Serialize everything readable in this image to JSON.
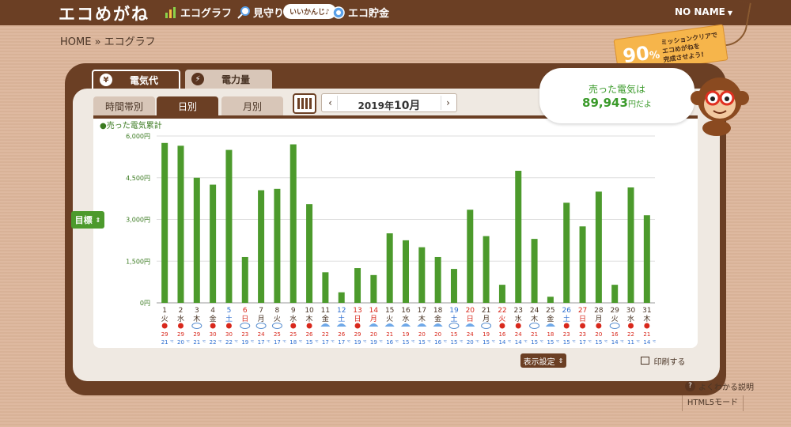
{
  "header": {
    "logo": "エコめがね",
    "nav": [
      {
        "label": "エコグラフ",
        "icon": "bar-chart-icon"
      },
      {
        "label": "見守り",
        "icon": "magnifier-icon"
      },
      {
        "label": "エコ貯金",
        "icon": "coin-icon"
      }
    ],
    "bubble": "いいかんじ♪",
    "user": "NO NAME"
  },
  "breadcrumb": "HOME » エコグラフ",
  "mission": {
    "percent": "90",
    "unit": "%",
    "text1": "ミッションクリアで",
    "text2": "エコめがねを",
    "text3": "完成させよう!"
  },
  "tabs": {
    "cost": "電気代",
    "amount": "電力量",
    "cost_icon": "¥",
    "amount_icon": "⚡"
  },
  "subtabs": [
    "時間帯別",
    "日別",
    "月別"
  ],
  "month": {
    "year": "2019年",
    "month": "10月"
  },
  "sold": {
    "label": "売った電気は",
    "value": "89,943",
    "unit": "円だよ"
  },
  "goal_button": "目標",
  "display_settings": "表示設定",
  "print": "印刷する",
  "help": "よくわかる説明",
  "html5": "HTML5モード",
  "colors": {
    "brown": "#6b3f24",
    "green": "#4c9a2c",
    "red": "#d8281c",
    "blue": "#2f6fd0"
  },
  "chart_data": {
    "type": "bar",
    "title": "●売った電気累計",
    "ylim": [
      0,
      6000
    ],
    "yticks": [
      "0円",
      "1,500円",
      "3,000円",
      "4,500円",
      "6,000円"
    ],
    "ytick_values": [
      0,
      1500,
      3000,
      4500,
      6000
    ],
    "categories": [
      "1",
      "2",
      "3",
      "4",
      "5",
      "6",
      "7",
      "8",
      "9",
      "10",
      "11",
      "12",
      "13",
      "14",
      "15",
      "16",
      "17",
      "18",
      "19",
      "20",
      "21",
      "22",
      "23",
      "24",
      "25",
      "26",
      "27",
      "28",
      "29",
      "30",
      "31"
    ],
    "weekdays": [
      "火",
      "水",
      "木",
      "金",
      "土",
      "日",
      "月",
      "火",
      "水",
      "木",
      "金",
      "土",
      "日",
      "月",
      "火",
      "水",
      "木",
      "金",
      "土",
      "日",
      "月",
      "火",
      "水",
      "木",
      "金",
      "土",
      "日",
      "月",
      "火",
      "水",
      "木"
    ],
    "holidays": [
      6,
      13,
      14,
      20,
      22,
      27
    ],
    "saturdays": [
      5,
      12,
      19,
      26
    ],
    "values": [
      5750,
      5650,
      4500,
      4250,
      5500,
      1650,
      4050,
      4100,
      5700,
      3550,
      1100,
      380,
      1250,
      1000,
      2500,
      2250,
      2000,
      1650,
      1220,
      3350,
      2400,
      650,
      4750,
      2300,
      220,
      3600,
      2750,
      4000,
      650,
      4150,
      3150
    ],
    "high": [
      29,
      29,
      29,
      30,
      30,
      23,
      24,
      25,
      25,
      26,
      22,
      26,
      29,
      20,
      21,
      19,
      20,
      20,
      15,
      24,
      19,
      16,
      24,
      21,
      18,
      23,
      23,
      20,
      16,
      22,
      21
    ],
    "low": [
      21,
      20,
      21,
      22,
      22,
      19,
      17,
      17,
      18,
      15,
      17,
      17,
      19,
      19,
      16,
      15,
      15,
      16,
      15,
      20,
      15,
      14,
      14,
      15,
      15,
      15,
      17,
      15,
      14,
      11,
      14
    ],
    "weather": [
      "sun",
      "sun",
      "cloud",
      "sun",
      "sun",
      "cloud",
      "cloud",
      "cloud",
      "sun",
      "sun",
      "rain",
      "rain",
      "sun",
      "rain",
      "rain",
      "rain",
      "rain",
      "rain",
      "cloud",
      "rain",
      "cloud",
      "sun",
      "sun",
      "cloud",
      "rain",
      "sun",
      "sun",
      "sun",
      "cloud",
      "sun",
      "sun"
    ],
    "temp_unit": "℃"
  }
}
